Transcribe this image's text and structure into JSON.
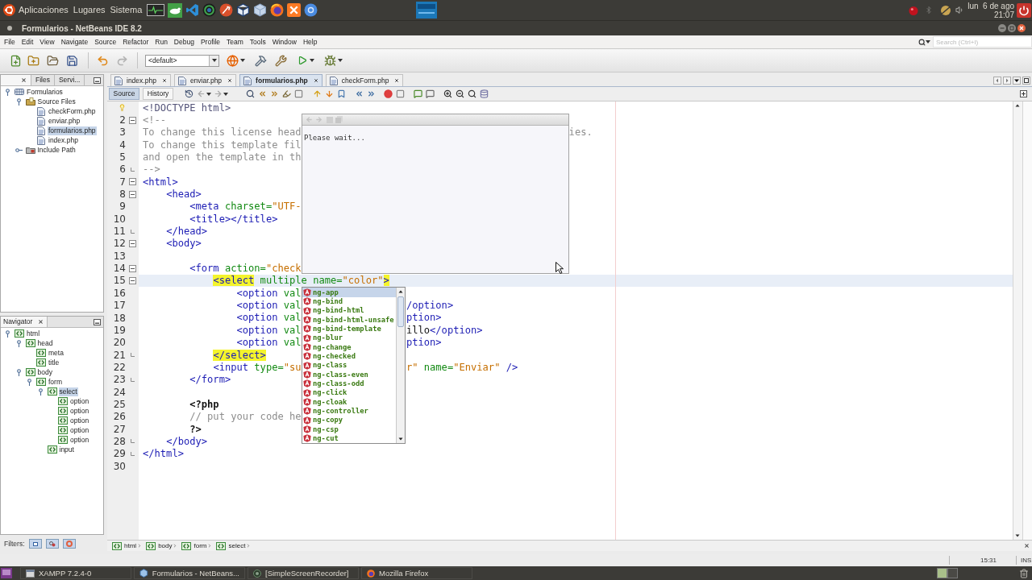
{
  "top_panel": {
    "menus": [
      "Aplicaciones",
      "Lugares",
      "Sistema"
    ],
    "clock": {
      "date": "lun  6 de ago",
      "time": "21:07"
    }
  },
  "window": {
    "title": "Formularios - NetBeans IDE 8.2"
  },
  "menu_bar": {
    "items": [
      "File",
      "Edit",
      "View",
      "Navigate",
      "Source",
      "Refactor",
      "Run",
      "Debug",
      "Profile",
      "Team",
      "Tools",
      "Window",
      "Help"
    ],
    "search": {
      "placeholder": "Search (Ctrl+I)"
    }
  },
  "toolbar": {
    "configuration": "<default>"
  },
  "projects_panel": {
    "tabs": [
      {
        "selected": true
      },
      {
        "label": "Files",
        "selected": false
      },
      {
        "label": "Servi...",
        "selected": false
      }
    ],
    "tree": [
      {
        "label": "Formularios",
        "kind": "project",
        "expanded": true,
        "selected": false,
        "children": [
          {
            "label": "Source Files",
            "kind": "folder",
            "expanded": true,
            "selected": false,
            "children": [
              {
                "label": "checkForm.php",
                "kind": "file",
                "selected": false
              },
              {
                "label": "enviar.php",
                "kind": "file",
                "selected": false
              },
              {
                "label": "formularios.php",
                "kind": "file",
                "selected": true
              },
              {
                "label": "index.php",
                "kind": "file",
                "selected": false
              }
            ]
          },
          {
            "label": "Include Path",
            "kind": "library",
            "expanded": false,
            "selected": false
          }
        ]
      }
    ]
  },
  "navigator": {
    "title": "Navigator",
    "tree": [
      {
        "label": "html",
        "expanded": true,
        "selected": false,
        "children": [
          {
            "label": "head",
            "expanded": true,
            "selected": false,
            "children": [
              {
                "label": "meta",
                "selected": false
              },
              {
                "label": "title",
                "selected": false
              }
            ]
          },
          {
            "label": "body",
            "expanded": true,
            "selected": false,
            "children": [
              {
                "label": "form",
                "expanded": true,
                "selected": false,
                "children": [
                  {
                    "label": "select",
                    "expanded": true,
                    "selected": true,
                    "children": [
                      {
                        "label": "option",
                        "selected": false
                      },
                      {
                        "label": "option",
                        "selected": false
                      },
                      {
                        "label": "option",
                        "selected": false
                      },
                      {
                        "label": "option",
                        "selected": false
                      },
                      {
                        "label": "option",
                        "selected": false
                      }
                    ]
                  },
                  {
                    "label": "input",
                    "selected": false
                  }
                ]
              }
            ]
          }
        ]
      }
    ],
    "filters": {
      "label": "Filters:",
      "buttons": [
        {
          "on": true
        },
        {
          "on": true
        },
        {
          "on": true
        }
      ]
    }
  },
  "editor": {
    "tabs": [
      {
        "label": "index.php",
        "selected": false
      },
      {
        "label": "enviar.php",
        "selected": false
      },
      {
        "label": "formularios.php",
        "selected": true
      },
      {
        "label": "checkForm.php",
        "selected": false
      }
    ],
    "views": [
      {
        "label": "Source",
        "selected": true
      },
      {
        "label": "History",
        "selected": false
      }
    ],
    "lines": [
      {
        "kind": "plain",
        "hint": true,
        "current": false,
        "tokens": [
          {
            "kind": "doctype",
            "text": "<!DOCTYPE html>"
          }
        ]
      },
      {
        "number": "2",
        "kind": "fold-start",
        "hint": false,
        "current": false,
        "tokens": [
          {
            "kind": "comment",
            "text": "<!--"
          }
        ]
      },
      {
        "number": "3",
        "kind": "plain",
        "hint": false,
        "current": false,
        "tokens": [
          {
            "kind": "comment",
            "text": "To change this license head"
          }
        ],
        "tokens_after": [
          {
            "kind": "comment",
            "text": "ies."
          }
        ]
      },
      {
        "number": "4",
        "kind": "plain",
        "hint": false,
        "current": false,
        "tokens": [
          {
            "kind": "comment",
            "text": "To change this template fil"
          }
        ]
      },
      {
        "number": "5",
        "kind": "plain",
        "hint": false,
        "current": false,
        "tokens": [
          {
            "kind": "comment",
            "text": "and open the template in th"
          }
        ]
      },
      {
        "number": "6",
        "kind": "fold-end",
        "hint": false,
        "current": false,
        "tokens": [
          {
            "kind": "comment",
            "text": "-->"
          }
        ]
      },
      {
        "number": "7",
        "kind": "fold-start",
        "hint": false,
        "current": false,
        "tokens": [
          {
            "kind": "tag",
            "text": "<html>"
          }
        ]
      },
      {
        "number": "8",
        "kind": "fold-start",
        "hint": false,
        "current": false,
        "tokens": [
          {
            "kind": "tag",
            "text": "    <head>"
          }
        ]
      },
      {
        "number": "9",
        "kind": "plain",
        "hint": false,
        "current": false,
        "tokens": [
          {
            "kind": "tag",
            "text": "        <meta"
          },
          {
            "kind": "attr",
            "text": " charset="
          },
          {
            "kind": "value",
            "text": "\"UTF-"
          }
        ]
      },
      {
        "number": "10",
        "kind": "plain",
        "hint": false,
        "current": false,
        "tokens": [
          {
            "kind": "tag",
            "text": "        <title></title>"
          }
        ]
      },
      {
        "number": "11",
        "kind": "fold-end",
        "hint": false,
        "current": false,
        "tokens": [
          {
            "kind": "tag",
            "text": "    </head>"
          }
        ]
      },
      {
        "number": "12",
        "kind": "fold-start",
        "hint": false,
        "current": false,
        "tokens": [
          {
            "kind": "tag",
            "text": "    <body>"
          }
        ]
      },
      {
        "number": "13",
        "kind": "plain",
        "hint": false,
        "current": false
      },
      {
        "number": "14",
        "kind": "fold-start",
        "hint": false,
        "current": false,
        "tokens": [
          {
            "kind": "tag",
            "text": "        <form"
          },
          {
            "kind": "attr",
            "text": " action="
          },
          {
            "kind": "value",
            "text": "\"check"
          }
        ]
      },
      {
        "number": "15",
        "kind": "fold-start",
        "hint": false,
        "current": true,
        "tokens": [
          {
            "kind": "tag-match",
            "text": "            <select"
          },
          {
            "kind": "attr",
            "text": " multiple name="
          },
          {
            "kind": "value",
            "text": "\"color\""
          },
          {
            "kind": "tag-match",
            "text": ">"
          }
        ]
      },
      {
        "number": "16",
        "kind": "plain",
        "hint": false,
        "current": false,
        "tokens": [
          {
            "kind": "tag",
            "text": "                <option"
          },
          {
            "kind": "attr",
            "text": " val"
          }
        ]
      },
      {
        "number": "17",
        "kind": "plain",
        "hint": false,
        "current": false,
        "tokens": [
          {
            "kind": "tag",
            "text": "                <option"
          },
          {
            "kind": "attr",
            "text": " val"
          }
        ],
        "tokens_after": [
          {
            "kind": "tag",
            "text": "/option>"
          }
        ]
      },
      {
        "number": "18",
        "kind": "plain",
        "hint": false,
        "current": false,
        "tokens": [
          {
            "kind": "tag",
            "text": "                <option"
          },
          {
            "kind": "attr",
            "text": " val"
          }
        ],
        "tokens_after": [
          {
            "kind": "tag",
            "text": "ption>"
          }
        ]
      },
      {
        "number": "19",
        "kind": "plain",
        "hint": false,
        "current": false,
        "tokens": [
          {
            "kind": "tag",
            "text": "                <option"
          },
          {
            "kind": "attr",
            "text": " val"
          }
        ],
        "tokens_after": [
          {
            "kind": "text",
            "text": "illo"
          },
          {
            "kind": "tag",
            "text": "</option>"
          }
        ]
      },
      {
        "number": "20",
        "kind": "plain",
        "hint": false,
        "current": false,
        "tokens": [
          {
            "kind": "tag",
            "text": "                <option"
          },
          {
            "kind": "attr",
            "text": " val"
          }
        ],
        "tokens_after": [
          {
            "kind": "tag",
            "text": "ption>"
          }
        ]
      },
      {
        "number": "21",
        "kind": "fold-end",
        "hint": false,
        "current": false,
        "tokens": [
          {
            "kind": "tag-match",
            "text": "            </select>"
          }
        ]
      },
      {
        "number": "22",
        "kind": "plain",
        "hint": false,
        "current": false,
        "tokens": [
          {
            "kind": "tag",
            "text": "            <input"
          },
          {
            "kind": "attr",
            "text": " type="
          },
          {
            "kind": "value",
            "text": "\"su"
          }
        ],
        "tokens_after": [
          {
            "kind": "value",
            "text": "r\""
          },
          {
            "kind": "attr",
            "text": " name="
          },
          {
            "kind": "value",
            "text": "\"Enviar\""
          },
          {
            "kind": "tag",
            "text": " />"
          }
        ]
      },
      {
        "number": "23",
        "kind": "fold-end",
        "hint": false,
        "current": false,
        "tokens": [
          {
            "kind": "tag",
            "text": "        </form>"
          }
        ]
      },
      {
        "number": "24",
        "kind": "plain",
        "hint": false,
        "current": false
      },
      {
        "number": "25",
        "kind": "plain",
        "hint": false,
        "current": false,
        "tokens": [
          {
            "kind": "php",
            "text": "        <?php"
          }
        ]
      },
      {
        "number": "26",
        "kind": "plain",
        "hint": false,
        "current": false,
        "tokens": [
          {
            "kind": "comment",
            "text": "        // put your code he"
          }
        ]
      },
      {
        "number": "27",
        "kind": "plain",
        "hint": false,
        "current": false,
        "tokens": [
          {
            "kind": "php",
            "text": "        ?>"
          }
        ]
      },
      {
        "number": "28",
        "kind": "fold-end",
        "hint": false,
        "current": false,
        "tokens": [
          {
            "kind": "tag",
            "text": "    </body>"
          }
        ]
      },
      {
        "number": "29",
        "kind": "fold-end",
        "hint": false,
        "current": false,
        "tokens": [
          {
            "kind": "tag",
            "text": "</html>"
          }
        ]
      },
      {
        "number": "30",
        "kind": "plain",
        "hint": false,
        "current": false
      }
    ],
    "documentation": {
      "text": "Please wait..."
    },
    "completion": {
      "items": [
        {
          "label": "ng-app",
          "selected": true
        },
        {
          "label": "ng-bind",
          "selected": false
        },
        {
          "label": "ng-bind-html",
          "selected": false
        },
        {
          "label": "ng-bind-html-unsafe",
          "selected": false
        },
        {
          "label": "ng-bind-template",
          "selected": false
        },
        {
          "label": "ng-blur",
          "selected": false
        },
        {
          "label": "ng-change",
          "selected": false
        },
        {
          "label": "ng-checked",
          "selected": false
        },
        {
          "label": "ng-class",
          "selected": false
        },
        {
          "label": "ng-class-even",
          "selected": false
        },
        {
          "label": "ng-class-odd",
          "selected": false
        },
        {
          "label": "ng-click",
          "selected": false
        },
        {
          "label": "ng-cloak",
          "selected": false
        },
        {
          "label": "ng-controller",
          "selected": false
        },
        {
          "label": "ng-copy",
          "selected": false
        },
        {
          "label": "ng-csp",
          "selected": false
        },
        {
          "label": "ng-cut",
          "selected": false
        }
      ]
    },
    "breadcrumb": [
      "html",
      "body",
      "form",
      "select"
    ]
  },
  "status_bar": {
    "position": "15:31",
    "mode": "INS"
  },
  "taskbar": {
    "items": [
      "XAMPP 7.2.4-0",
      "Formularios - NetBeans...",
      "[SimpleScreenRecorder]",
      "Mozilla Firefox"
    ]
  }
}
